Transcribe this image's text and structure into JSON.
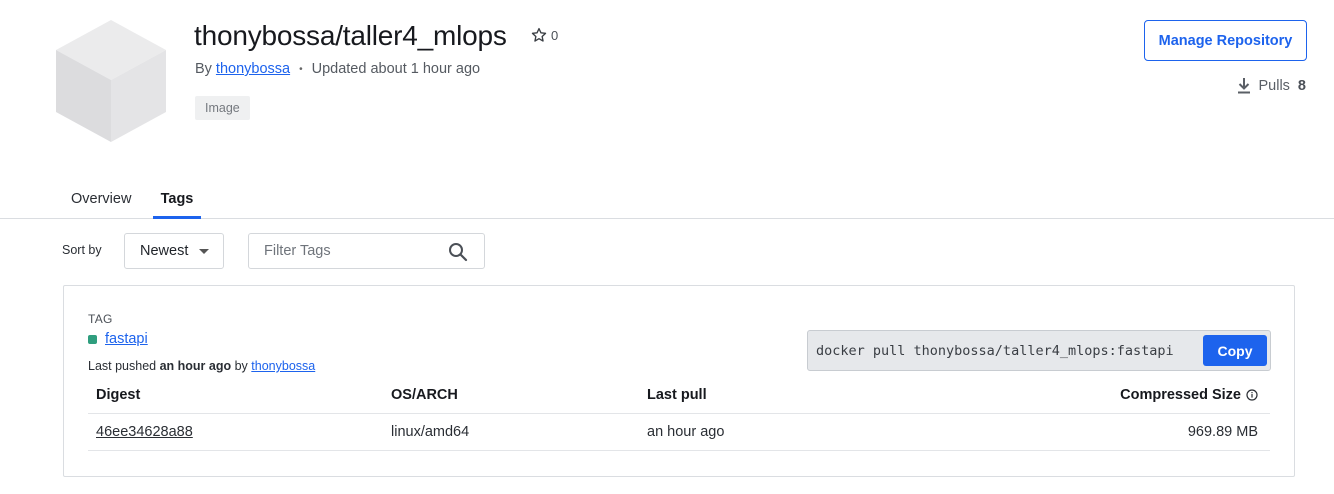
{
  "repo": {
    "title": "thonybossa/taller4_mlops",
    "stars": "0",
    "by_label": "By",
    "owner": "thonybossa",
    "dot": "•",
    "updated": "Updated about 1 hour ago",
    "badge": "Image"
  },
  "actions": {
    "manage_label": "Manage Repository",
    "pulls_label": "Pulls",
    "pulls_count": "8"
  },
  "tabs": [
    {
      "label": "Overview"
    },
    {
      "label": "Tags"
    }
  ],
  "controls": {
    "sort_label": "Sort by",
    "sort_value": "Newest",
    "filter_placeholder": "Filter Tags"
  },
  "tag_card": {
    "header": "TAG",
    "name": "fastapi",
    "pushed_prefix": "Last pushed",
    "pushed_time": "an hour ago",
    "pushed_by": "by",
    "pushed_user": "thonybossa",
    "pull_command": "docker pull thonybossa/taller4_mlops:fastapi",
    "copy_label": "Copy",
    "columns": [
      "Digest",
      "OS/ARCH",
      "Last pull",
      "Compressed Size"
    ],
    "rows": [
      {
        "digest": "46ee34628a88",
        "os_arch": "linux/amd64",
        "last_pull": "an hour ago",
        "size": "969.89 MB"
      }
    ]
  },
  "colors": {
    "accent": "#1d63ed",
    "tag_status": "#2f9e7e"
  }
}
